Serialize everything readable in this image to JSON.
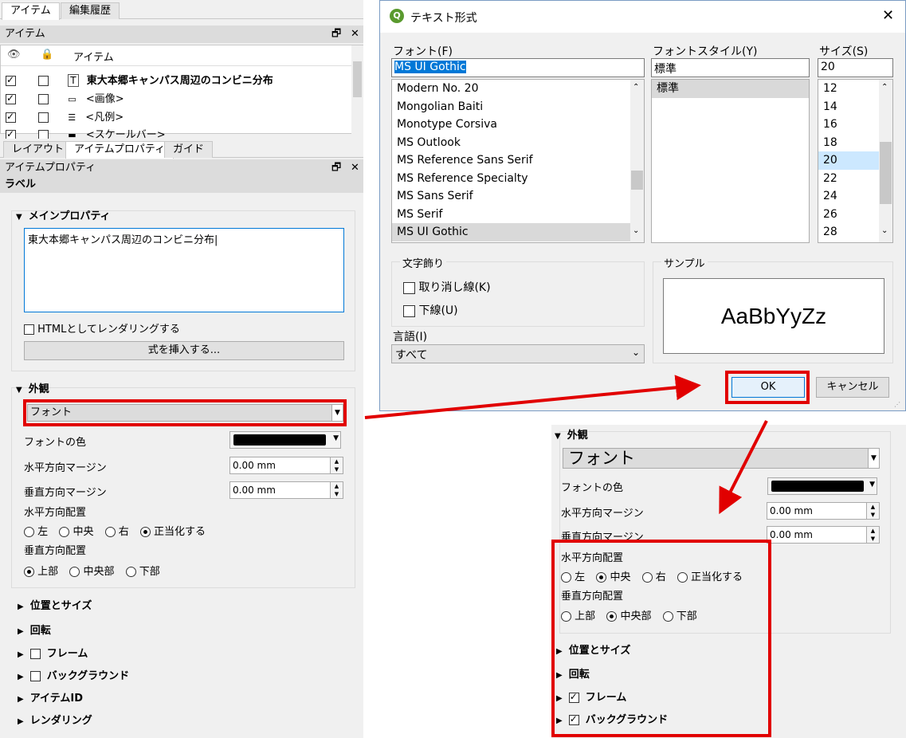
{
  "left": {
    "top_tabs": [
      "アイテム",
      "編集履歴"
    ],
    "items_dock_title": "アイテム",
    "items_header": "アイテム",
    "items": [
      {
        "label": "東大本郷キャンパス周辺のコンビニ分布",
        "visible": true,
        "locked": false,
        "icon": "text-icon"
      },
      {
        "label": "<画像>",
        "visible": true,
        "locked": false,
        "icon": "image-icon"
      },
      {
        "label": "<凡例>",
        "visible": true,
        "locked": false,
        "icon": "legend-icon"
      },
      {
        "label": "<スケールバー>",
        "visible": true,
        "locked": false,
        "icon": "scalebar-icon"
      }
    ],
    "bottom_tabs": [
      "レイアウト",
      "アイテムプロパティ",
      "ガイド"
    ],
    "props_dock_title": "アイテムプロパティ",
    "item_type": "ラベル",
    "main_props_title": "メインプロパティ",
    "label_text": "東大本郷キャンパス周辺のコンビニ分布",
    "html_render_label": "HTMLとしてレンダリングする",
    "insert_expr_label": "式を挿入する...",
    "appearance_title": "外観",
    "font_button": "フォント",
    "font_color_label": "フォントの色",
    "h_margin_label": "水平方向マージン",
    "h_margin_value": "0.00 mm",
    "v_margin_label": "垂直方向マージン",
    "v_margin_value": "0.00 mm",
    "h_align_label": "水平方向配置",
    "h_align_options": [
      "左",
      "中央",
      "右",
      "正当化する"
    ],
    "v_align_label": "垂直方向配置",
    "v_align_options": [
      "上部",
      "中央部",
      "下部"
    ],
    "collapsed_sections": [
      "位置とサイズ",
      "回転",
      "フレーム",
      "バックグラウンド",
      "アイテムID",
      "レンダリング"
    ]
  },
  "dialog": {
    "title": "テキスト形式",
    "font_label": "フォント(F)",
    "font_value": "MS UI Gothic",
    "fonts": [
      "Modern No. 20",
      "Mongolian Baiti",
      "Monotype Corsiva",
      "MS Outlook",
      "MS Reference Sans Serif",
      "MS Reference Specialty",
      "MS Sans Serif",
      "MS Serif",
      "MS UI Gothic"
    ],
    "style_label": "フォントスタイル(Y)",
    "style_value": "標準",
    "styles": [
      "標準"
    ],
    "size_label": "サイズ(S)",
    "size_value": "20",
    "sizes": [
      "12",
      "14",
      "16",
      "18",
      "20",
      "22",
      "24",
      "26",
      "28"
    ],
    "effects_title": "文字飾り",
    "strike_label": "取り消し線(K)",
    "underline_label": "下線(U)",
    "sample_title": "サンプル",
    "sample_text": "AaBbYyZz",
    "lang_label": "言語(I)",
    "lang_value": "すべて",
    "ok_label": "OK",
    "cancel_label": "キャンセル"
  },
  "snippet": {
    "appearance_title": "外観",
    "font_button": "フォント",
    "font_color_label": "フォントの色",
    "h_margin_label": "水平方向マージン",
    "h_margin_value": "0.00 mm",
    "v_margin_label": "垂直方向マージン",
    "v_margin_value": "0.00 mm",
    "h_align_label": "水平方向配置",
    "h_align_options": [
      "左",
      "中央",
      "右",
      "正当化する"
    ],
    "v_align_label": "垂直方向配置",
    "v_align_options": [
      "上部",
      "中央部",
      "下部"
    ],
    "sections": [
      "位置とサイズ",
      "回転",
      "フレーム",
      "バックグラウンド"
    ]
  },
  "colors": {
    "highlight": "#e10000",
    "selection": "#0078d7",
    "font_color": "#000000"
  }
}
